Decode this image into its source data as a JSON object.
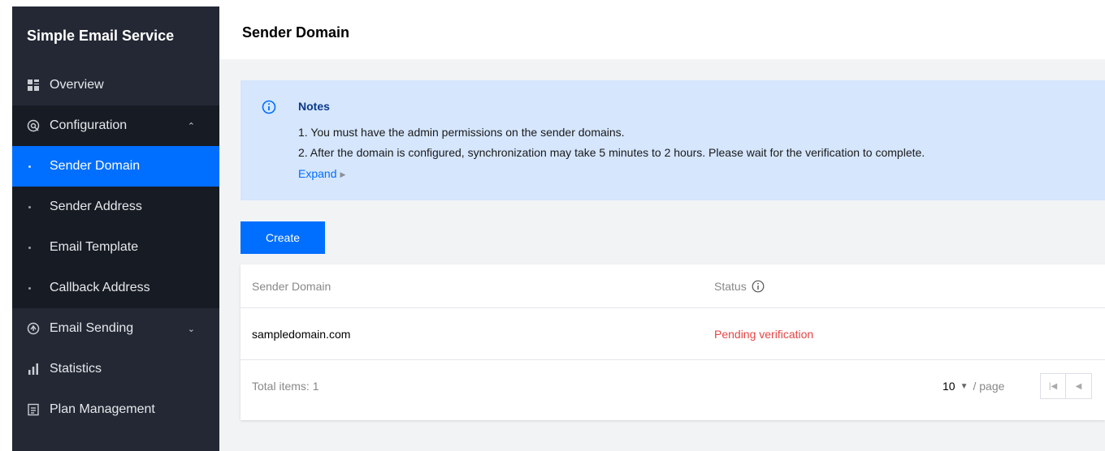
{
  "sidebar": {
    "title": "Simple Email Service",
    "items": [
      {
        "label": "Overview",
        "icon": "grid-icon"
      },
      {
        "label": "Configuration",
        "icon": "config-icon",
        "expanded": true
      },
      {
        "label": "Email Sending",
        "icon": "sending-icon",
        "expanded": false
      },
      {
        "label": "Statistics",
        "icon": "bar-chart-icon"
      },
      {
        "label": "Plan Management",
        "icon": "document-icon"
      }
    ],
    "sub_items": [
      {
        "label": "Sender Domain",
        "active": true
      },
      {
        "label": "Sender Address"
      },
      {
        "label": "Email Template"
      },
      {
        "label": "Callback Address"
      }
    ]
  },
  "header": {
    "title": "Sender Domain"
  },
  "notes": {
    "title": "Notes",
    "lines": [
      "1. You must have the admin permissions on the sender domains.",
      "2. After the domain is configured, synchronization may take 5 minutes to 2 hours. Please wait for the verification to complete."
    ],
    "expand_label": "Expand"
  },
  "toolbar": {
    "create_label": "Create"
  },
  "table": {
    "columns": [
      "Sender Domain",
      "Status"
    ],
    "rows": [
      {
        "domain": "sampledomain.com",
        "status": "Pending verification"
      }
    ],
    "total_label": "Total items: 1",
    "page_size": "10",
    "per_page_label": "/ page"
  },
  "colors": {
    "accent": "#006eff",
    "sidebar_bg": "#232834",
    "notes_bg": "#d5e6fd",
    "status_pending": "#e54545"
  }
}
